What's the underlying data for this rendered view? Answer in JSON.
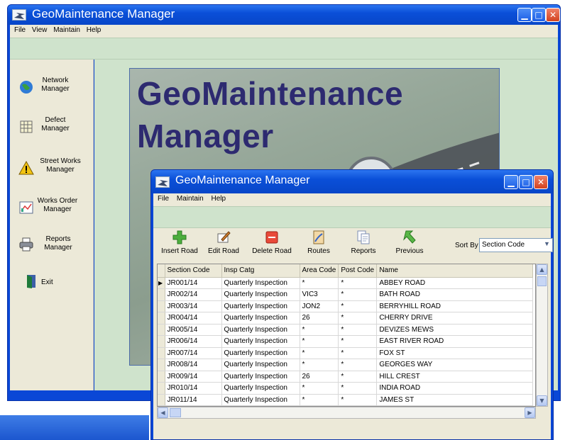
{
  "main_window": {
    "title": "GeoMaintenance Manager",
    "menu": [
      "File",
      "View",
      "Maintain",
      "Help"
    ],
    "sidebar": [
      {
        "label": "Network Manager",
        "icon": "globe-icon"
      },
      {
        "label": "Defect Manager",
        "icon": "grid-icon"
      },
      {
        "label": "Street Works Manager",
        "icon": "warning-icon"
      },
      {
        "label": "Works Order Manager",
        "icon": "chart-icon"
      },
      {
        "label": "Reports Manager",
        "icon": "printer-icon"
      },
      {
        "label": "Exit",
        "icon": "exit-door-icon"
      }
    ],
    "banner_lines": [
      "GeoMaintenance",
      "Manager"
    ]
  },
  "child_window": {
    "title": "GeoMaintenance Manager",
    "menu": [
      "File",
      "Maintain",
      "Help"
    ],
    "toolbar": [
      {
        "label": "Insert Road",
        "icon": "plus-icon"
      },
      {
        "label": "Edit Road",
        "icon": "edit-icon"
      },
      {
        "label": "Delete Road",
        "icon": "minus-icon"
      },
      {
        "label": "Routes",
        "icon": "map-icon"
      },
      {
        "label": "Reports",
        "icon": "document-icon"
      },
      {
        "label": "Previous",
        "icon": "back-arrow-icon"
      }
    ],
    "sort_by_label": "Sort By",
    "sort_by_value": "Section Code",
    "table": {
      "columns": [
        "Section Code",
        "Insp Catg",
        "Area Code",
        "Post Code",
        "Name"
      ],
      "rows": [
        [
          "JR001/14",
          "Quarterly Inspection",
          "*",
          "*",
          "ABBEY ROAD"
        ],
        [
          "JR002/14",
          "Quarterly Inspection",
          "VIC3",
          "*",
          "BATH ROAD"
        ],
        [
          "JR003/14",
          "Quarterly Inspection",
          "JON2",
          "*",
          "BERRYHILL ROAD"
        ],
        [
          "JR004/14",
          "Quarterly Inspection",
          "26",
          "*",
          "CHERRY DRIVE"
        ],
        [
          "JR005/14",
          "Quarterly Inspection",
          "*",
          "*",
          "DEVIZES MEWS"
        ],
        [
          "JR006/14",
          "Quarterly Inspection",
          "*",
          "*",
          "EAST RIVER ROAD"
        ],
        [
          "JR007/14",
          "Quarterly Inspection",
          "*",
          "*",
          "FOX ST"
        ],
        [
          "JR008/14",
          "Quarterly Inspection",
          "*",
          "*",
          "GEORGES WAY"
        ],
        [
          "JR009/14",
          "Quarterly Inspection",
          "26",
          "*",
          "HILL CREST"
        ],
        [
          "JR010/14",
          "Quarterly Inspection",
          "*",
          "*",
          "INDIA ROAD"
        ],
        [
          "JR011/14",
          "Quarterly Inspection",
          "*",
          "*",
          "JAMES ST"
        ]
      ]
    }
  }
}
